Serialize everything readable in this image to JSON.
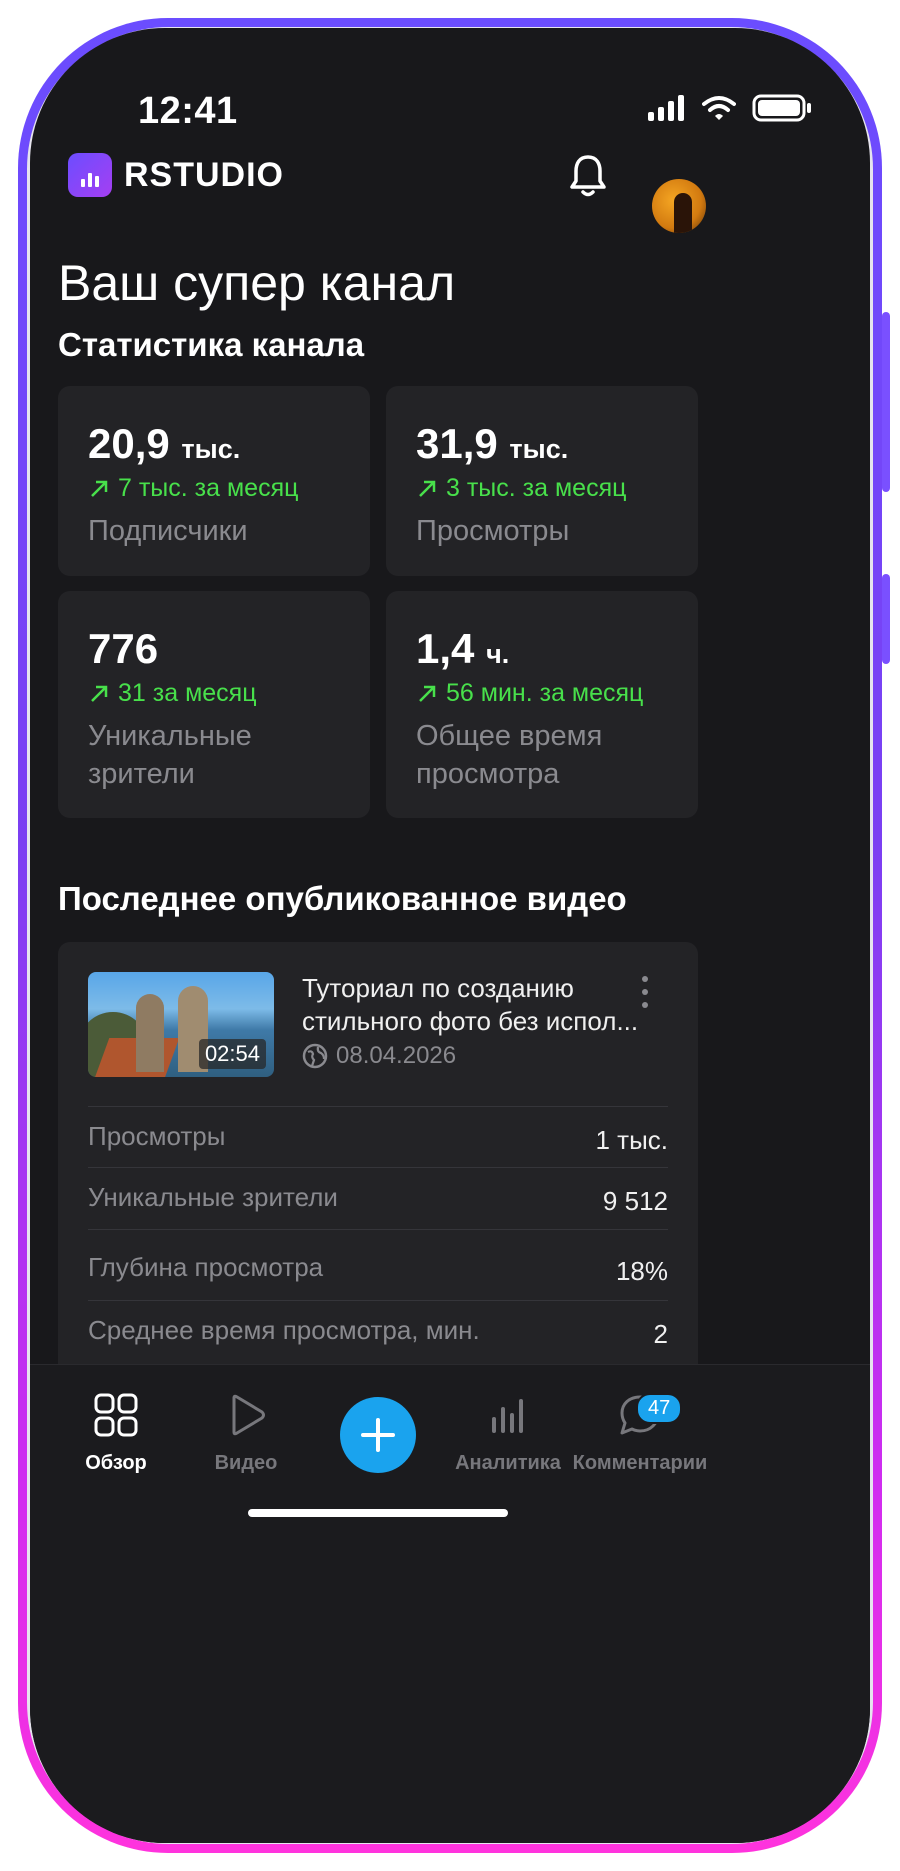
{
  "status_bar": {
    "time": "12:41"
  },
  "header": {
    "app_name": "RSTUDIO"
  },
  "page": {
    "title": "Ваш супер канал"
  },
  "channel_stats": {
    "title": "Статистика канала",
    "cards": [
      {
        "value": "20,9",
        "unit": "тыс.",
        "delta": "7 тыс. за месяц",
        "label": "Подписчики"
      },
      {
        "value": "31,9",
        "unit": "тыс.",
        "delta": "3 тыс. за месяц",
        "label": "Просмотры"
      },
      {
        "value": "776",
        "unit": "",
        "delta": "31 за месяц",
        "label": "Уникальные зрители"
      },
      {
        "value": "1,4",
        "unit": "ч.",
        "delta": "56 мин. за месяц",
        "label": "Общее время просмотра"
      }
    ]
  },
  "latest_video": {
    "section_title": "Последнее опубликованное видео",
    "title": "Туториал по созданию стильного фото без испол...",
    "duration": "02:54",
    "date": "08.04.2026",
    "metrics": [
      {
        "label": "Просмотры",
        "value": "1 тыс."
      },
      {
        "label": "Уникальные зрители",
        "value": "9 512"
      },
      {
        "label": "Глубина просмотра",
        "value": "18%"
      },
      {
        "label": "Среднее время просмотра, мин.",
        "value": "2"
      }
    ]
  },
  "tab_bar": {
    "tabs": [
      {
        "label": "Обзор",
        "icon": "grid-icon",
        "active": true
      },
      {
        "label": "Видео",
        "icon": "play-icon",
        "active": false
      },
      {
        "label": "Аналитика",
        "icon": "bar-chart-icon",
        "active": false
      },
      {
        "label": "Комментарии",
        "icon": "chat-icon",
        "active": false
      }
    ],
    "comments_badge": "47",
    "accent_color": "#1aa3ee"
  },
  "colors": {
    "positive_delta": "#48e04b",
    "background": "#18181b",
    "card": "#232326"
  }
}
